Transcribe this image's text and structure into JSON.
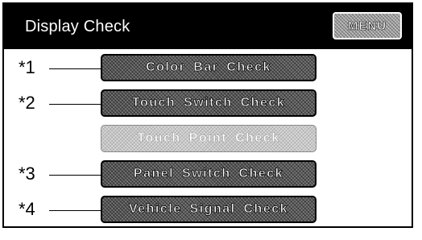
{
  "header": {
    "title": "Display Check",
    "menu_label": "MENU"
  },
  "items": [
    {
      "marker": "*1",
      "label": "Color  Bar  Check",
      "enabled": true
    },
    {
      "marker": "*2",
      "label": "Touch  Switch  Check",
      "enabled": true
    },
    {
      "marker": "",
      "label": "Touch  Point Check",
      "enabled": false
    },
    {
      "marker": "*3",
      "label": "Panel Switch  Check",
      "enabled": true
    },
    {
      "marker": "*4",
      "label": "Vehicle  Signal  Check",
      "enabled": true
    }
  ],
  "colors": {
    "title_bar": "#000000",
    "button_fill": "#5a5a5a",
    "disabled_fill": "#c4c4c4"
  }
}
